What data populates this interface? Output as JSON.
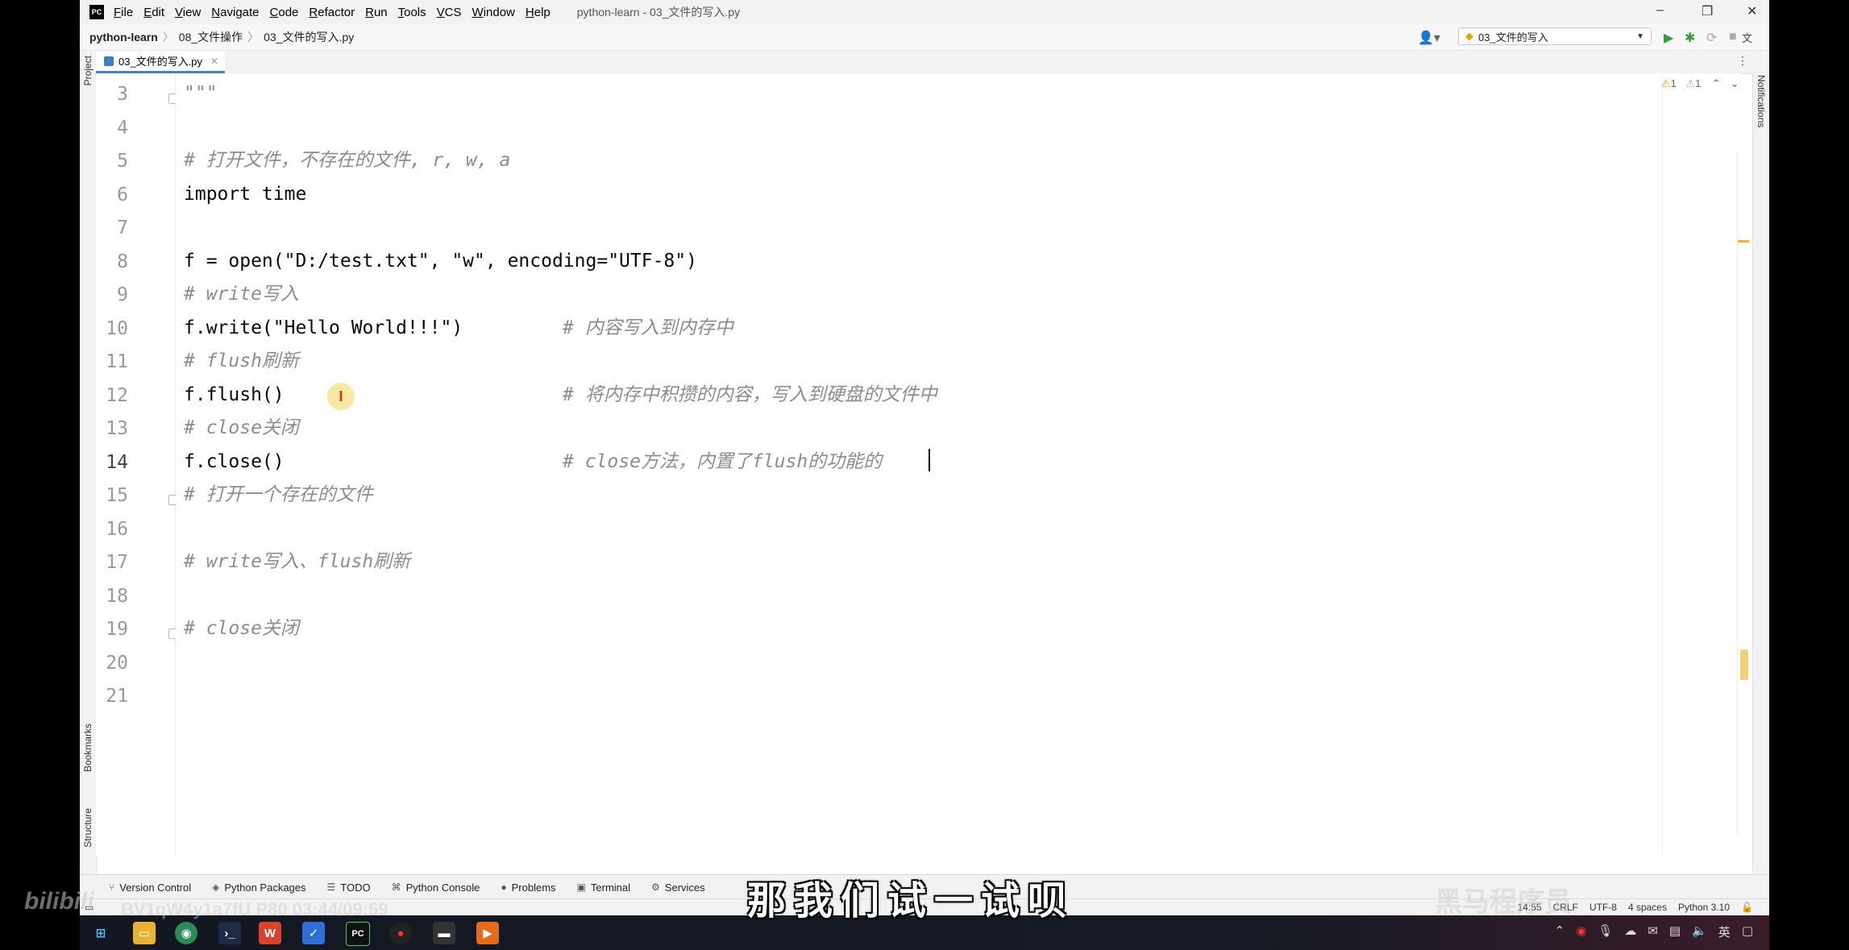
{
  "app": {
    "logo": "PC",
    "window_title": "python-learn - 03_文件的写入.py",
    "menu": [
      "File",
      "Edit",
      "View",
      "Navigate",
      "Code",
      "Refactor",
      "Run",
      "Tools",
      "VCS",
      "Window",
      "Help"
    ]
  },
  "navbar": {
    "breadcrumbs": [
      "python-learn",
      "08_文件操作",
      "03_文件的写入.py"
    ],
    "run_config": "03_文件的写入"
  },
  "tabs": [
    {
      "label": "03_文件的写入.py",
      "active": true
    }
  ],
  "side_tabs": {
    "left": [
      "Project",
      "Bookmarks",
      "Structure"
    ],
    "right": [
      "Notifications"
    ]
  },
  "inspections": {
    "warnings": "1",
    "weak_warnings": "1"
  },
  "editor": {
    "current_line": 14,
    "lines": [
      {
        "num": "3",
        "text": "\"\"\"",
        "cls": "cmt"
      },
      {
        "num": "4",
        "text": ""
      },
      {
        "num": "5",
        "text": "# 打开文件，不存在的文件, r, w, a",
        "cls": "cmt"
      },
      {
        "num": "6",
        "text": "import time"
      },
      {
        "num": "7",
        "text": ""
      },
      {
        "num": "8",
        "text": "f = open(\"D:/test.txt\", \"w\", encoding=\"UTF-8\")"
      },
      {
        "num": "9",
        "text": "# write写入",
        "cls": "cmt"
      },
      {
        "num": "10",
        "text": "f.write(\"Hello World!!!\")",
        "comment": "# 内容写入到内存中"
      },
      {
        "num": "11",
        "text": "# flush刷新",
        "cls": "cmt"
      },
      {
        "num": "12",
        "text": "f.flush()",
        "comment": "# 将内存中积攒的内容，写入到硬盘的文件中"
      },
      {
        "num": "13",
        "text": "# close关闭",
        "cls": "cmt"
      },
      {
        "num": "14",
        "text": "f.close()",
        "comment": "# close方法，内置了flush的功能的"
      },
      {
        "num": "15",
        "text": "# 打开一个存在的文件",
        "cls": "cmt"
      },
      {
        "num": "16",
        "text": ""
      },
      {
        "num": "17",
        "text": "# write写入、flush刷新",
        "cls": "cmt"
      },
      {
        "num": "18",
        "text": ""
      },
      {
        "num": "19",
        "text": "# close关闭",
        "cls": "cmt"
      },
      {
        "num": "20",
        "text": ""
      },
      {
        "num": "21",
        "text": ""
      }
    ]
  },
  "tool_windows": [
    "Version Control",
    "Python Packages",
    "TODO",
    "Python Console",
    "Problems",
    "Terminal",
    "Services"
  ],
  "statusbar": {
    "position": "14:55",
    "line_sep": "CRLF",
    "encoding": "UTF-8",
    "indent": "4 spaces",
    "interpreter": "Python 3.10"
  },
  "taskbar": {
    "tray": {
      "ime": "英"
    }
  },
  "overlay": {
    "subtitle": "那我们试一试呗",
    "watermark": "bilibili",
    "video_id": "BV1qW4y1a7fU P80 03:44/09:59",
    "channel": "黑马程序员"
  }
}
